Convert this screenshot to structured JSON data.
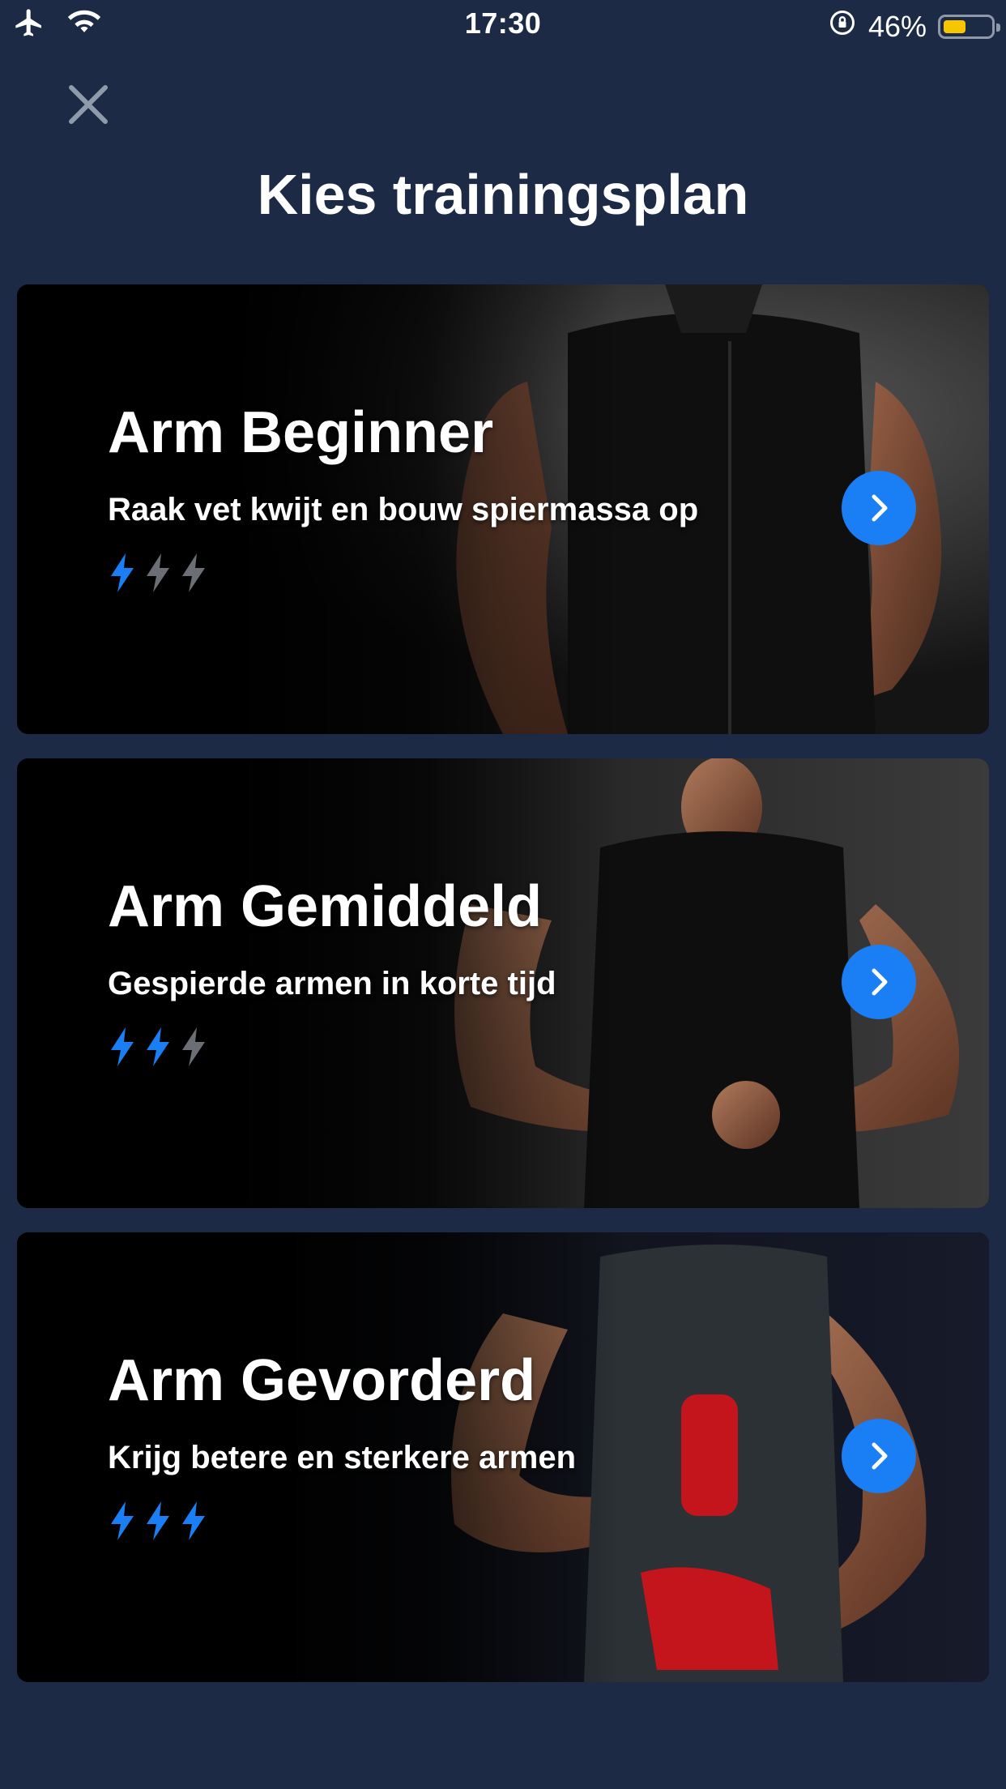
{
  "status_bar": {
    "time": "17:30",
    "battery_percent": "46%",
    "battery_level": 0.46,
    "icons": [
      "airplane-icon",
      "wifi-icon",
      "orientation-lock-icon",
      "battery-icon"
    ]
  },
  "header": {
    "close_icon": "close-icon",
    "title": "Kies trainingsplan"
  },
  "plans": [
    {
      "title": "Arm Beginner",
      "subtitle": "Raak vet kwijt en bouw spiermassa op",
      "level": 1,
      "max_level": 3
    },
    {
      "title": "Arm Gemiddeld",
      "subtitle": "Gespierde armen in korte tijd",
      "level": 2,
      "max_level": 3
    },
    {
      "title": "Arm Gevorderd",
      "subtitle": "Krijg betere en sterkere armen",
      "level": 3,
      "max_level": 3
    }
  ],
  "colors": {
    "background": "#1c2a45",
    "accent": "#1a7ef5",
    "bolt_inactive": "#6b6e74",
    "battery": "#f7c600"
  }
}
